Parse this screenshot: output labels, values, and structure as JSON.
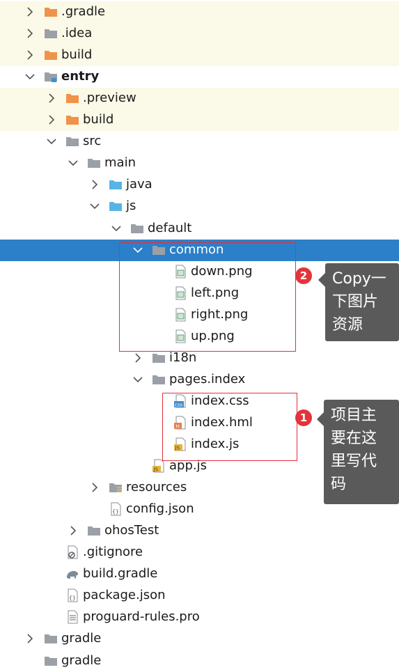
{
  "tree": {
    "rows": [
      {
        "label": ".gradle",
        "depth": 0,
        "arrow": "right",
        "icon": "folder-orange",
        "bg": "yellow"
      },
      {
        "label": ".idea",
        "depth": 0,
        "arrow": "right",
        "icon": "folder-gray",
        "bg": "yellow"
      },
      {
        "label": "build",
        "depth": 0,
        "arrow": "right",
        "icon": "folder-orange",
        "bg": "yellow"
      },
      {
        "label": "entry",
        "depth": 0,
        "arrow": "down",
        "icon": "folder-module",
        "bold": true
      },
      {
        "label": ".preview",
        "depth": 1,
        "arrow": "right",
        "icon": "folder-orange",
        "bg": "yellow"
      },
      {
        "label": "build",
        "depth": 1,
        "arrow": "right",
        "icon": "folder-orange",
        "bg": "yellow"
      },
      {
        "label": "src",
        "depth": 1,
        "arrow": "down",
        "icon": "folder-gray"
      },
      {
        "label": "main",
        "depth": 2,
        "arrow": "down",
        "icon": "folder-gray"
      },
      {
        "label": "java",
        "depth": 3,
        "arrow": "right",
        "icon": "folder-blue"
      },
      {
        "label": "js",
        "depth": 3,
        "arrow": "down",
        "icon": "folder-blue"
      },
      {
        "label": "default",
        "depth": 4,
        "arrow": "down",
        "icon": "folder-gray"
      },
      {
        "label": "common",
        "depth": 5,
        "arrow": "down",
        "icon": "folder-gray",
        "bg": "selected"
      },
      {
        "label": "down.png",
        "depth": 6,
        "arrow": "none",
        "icon": "file-image"
      },
      {
        "label": "left.png",
        "depth": 6,
        "arrow": "none",
        "icon": "file-image"
      },
      {
        "label": "right.png",
        "depth": 6,
        "arrow": "none",
        "icon": "file-image"
      },
      {
        "label": "up.png",
        "depth": 6,
        "arrow": "none",
        "icon": "file-image"
      },
      {
        "label": "i18n",
        "depth": 5,
        "arrow": "right",
        "icon": "folder-gray"
      },
      {
        "label": "pages.index",
        "depth": 5,
        "arrow": "down",
        "icon": "folder-gray"
      },
      {
        "label": "index.css",
        "depth": 6,
        "arrow": "none",
        "icon": "file-css"
      },
      {
        "label": "index.hml",
        "depth": 6,
        "arrow": "none",
        "icon": "file-hml"
      },
      {
        "label": "index.js",
        "depth": 6,
        "arrow": "none",
        "icon": "file-js"
      },
      {
        "label": "app.js",
        "depth": 5,
        "arrow": "none",
        "icon": "file-js"
      },
      {
        "label": "resources",
        "depth": 3,
        "arrow": "right",
        "icon": "folder-resources"
      },
      {
        "label": "config.json",
        "depth": 3,
        "arrow": "none",
        "icon": "file-json"
      },
      {
        "label": "ohosTest",
        "depth": 2,
        "arrow": "right",
        "icon": "folder-gray"
      },
      {
        "label": ".gitignore",
        "depth": 1,
        "arrow": "none",
        "icon": "file-ignore"
      },
      {
        "label": "build.gradle",
        "depth": 1,
        "arrow": "none",
        "icon": "file-gradle"
      },
      {
        "label": "package.json",
        "depth": 1,
        "arrow": "none",
        "icon": "file-json"
      },
      {
        "label": "proguard-rules.pro",
        "depth": 1,
        "arrow": "none",
        "icon": "file-text"
      },
      {
        "label": "gradle",
        "depth": 0,
        "arrow": "right",
        "icon": "folder-gray"
      },
      {
        "label": "gradle",
        "depth": 0,
        "arrow": "none",
        "icon": "folder-gray"
      }
    ]
  },
  "annotations": {
    "badge_1": "1",
    "badge_2": "2",
    "callout_1": "项目主\n要在这\n里写代\n码",
    "callout_2": "Copy一\n下图片\n资源"
  },
  "colors": {
    "selected": "#2c7fc9",
    "excluded_bg": "#fbf9e7",
    "folder_orange": "#f0924a",
    "folder_gray": "#9aa0a6",
    "folder_blue": "#56b5e4",
    "highlight_red": "#e0313a",
    "callout_bg": "#5a5a5a"
  }
}
